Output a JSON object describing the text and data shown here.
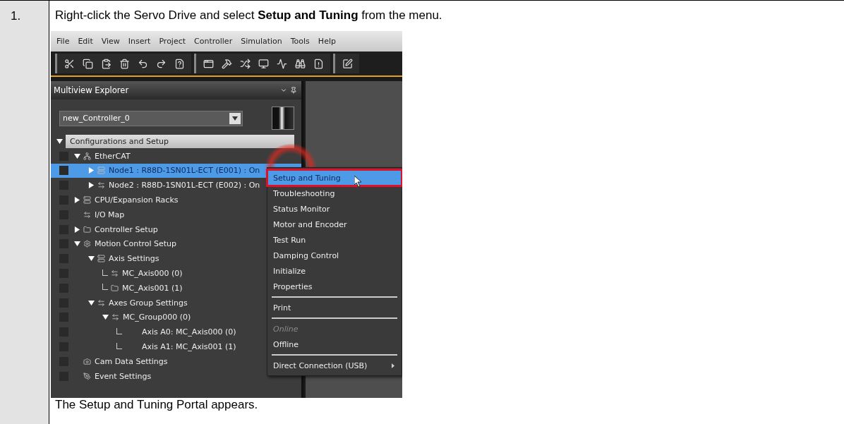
{
  "step": {
    "number": "1.",
    "instruction": "Right-click the Servo Drive and select **Setup and Tuning** from the menu.",
    "result": "The Setup and Tuning Portal appears."
  },
  "app": {
    "menu_bar": [
      "File",
      "Edit",
      "View",
      "Insert",
      "Project",
      "Controller",
      "Simulation",
      "Tools",
      "Help"
    ],
    "panel": {
      "title": "Multiview Explorer",
      "controller": "new_Controller_0",
      "tree": [
        {
          "label": "Configurations and Setup",
          "kind": "root",
          "expanded": true,
          "selected": false,
          "children": [
            {
              "label": "EtherCAT",
              "kind": "item",
              "expanded": true,
              "selected": false,
              "children": [
                {
                  "label": "Node1 : R88D-1SN01L-ECT (E001) : On",
                  "kind": "item",
                  "expanded": false,
                  "selected": true
                },
                {
                  "label": "Node2 : R88D-1SN01L-ECT (E002) : On",
                  "kind": "item",
                  "expanded": false,
                  "selected": false
                }
              ]
            },
            {
              "label": "CPU/Expansion Racks",
              "kind": "item",
              "expanded": false,
              "selected": false
            },
            {
              "label": "I/O Map",
              "kind": "item",
              "selected": false
            },
            {
              "label": "Controller Setup",
              "kind": "item",
              "expanded": false,
              "selected": false
            },
            {
              "label": "Motion Control Setup",
              "kind": "item",
              "expanded": true,
              "selected": false,
              "children": [
                {
                  "label": "Axis Settings",
                  "kind": "item",
                  "expanded": true,
                  "selected": false,
                  "children": [
                    {
                      "label": "MC_Axis000 (0)",
                      "kind": "connector",
                      "selected": false
                    },
                    {
                      "label": "MC_Axis001 (1)",
                      "kind": "connector",
                      "selected": false
                    }
                  ]
                },
                {
                  "label": "Axes Group Settings",
                  "kind": "item",
                  "expanded": true,
                  "selected": false,
                  "children": [
                    {
                      "label": "MC_Group000 (0)",
                      "kind": "item",
                      "expanded": true,
                      "selected": false,
                      "children": [
                        {
                          "label": "Axis A0: MC_Axis000 (0)",
                          "kind": "reference",
                          "selected": false
                        },
                        {
                          "label": "Axis A1: MC_Axis001 (1)",
                          "kind": "reference",
                          "selected": false
                        }
                      ]
                    }
                  ]
                }
              ]
            },
            {
              "label": "Cam Data Settings",
              "kind": "item",
              "selected": false
            },
            {
              "label": "Event Settings",
              "kind": "item",
              "selected": false
            }
          ]
        }
      ]
    },
    "context_menu": [
      [
        {
          "label": "Setup and Tuning",
          "selected": true,
          "disabled": false
        },
        {
          "label": "Troubleshooting",
          "selected": false,
          "disabled": false
        },
        {
          "label": "Status Monitor",
          "selected": false,
          "disabled": false
        },
        {
          "label": "Motor and Encoder",
          "selected": false,
          "disabled": false
        },
        {
          "label": "Test Run",
          "selected": false,
          "disabled": false
        },
        {
          "label": "Damping Control",
          "selected": false,
          "disabled": false
        },
        {
          "label": "Initialize",
          "selected": false,
          "disabled": false
        },
        {
          "label": "Properties",
          "selected": false,
          "disabled": false
        }
      ],
      [
        {
          "label": "Print",
          "selected": false,
          "disabled": false
        }
      ],
      [
        {
          "label": "Online",
          "selected": false,
          "disabled": true
        },
        {
          "label": "Offline",
          "selected": false,
          "disabled": false
        }
      ],
      [
        {
          "label": "Direct Connection (USB)",
          "selected": false,
          "disabled": false,
          "submenu": true
        }
      ]
    ]
  }
}
